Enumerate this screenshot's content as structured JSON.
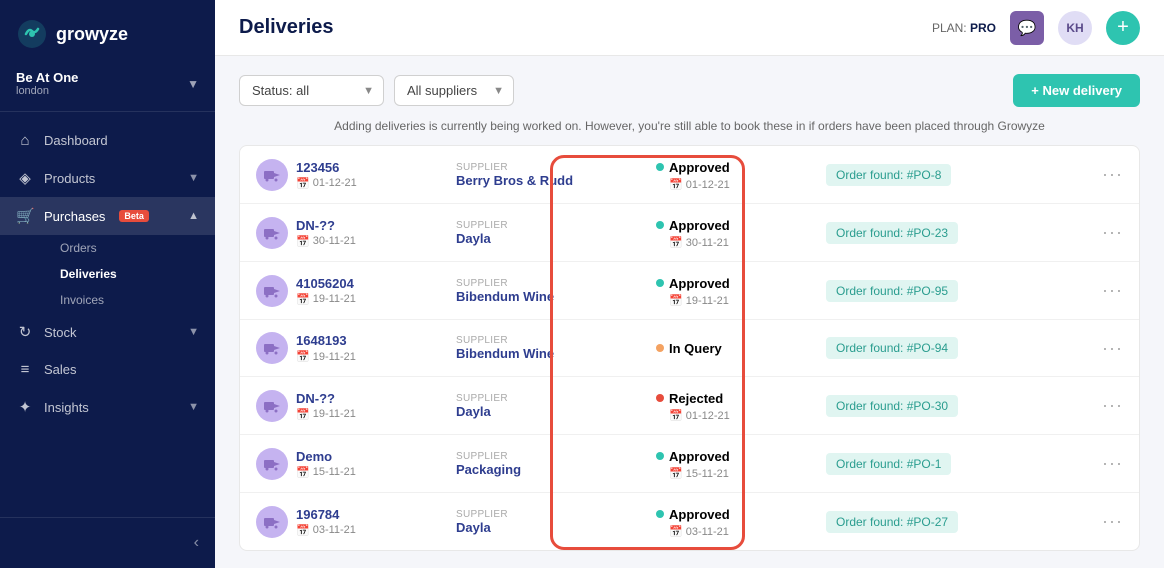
{
  "app": {
    "logo_text": "growyze",
    "plan_label": "PLAN:",
    "plan_value": "PRO",
    "avatar_initials": "KH"
  },
  "sidebar": {
    "org_name": "Be At One",
    "org_location": "london",
    "nav_items": [
      {
        "id": "dashboard",
        "label": "Dashboard",
        "icon": "🏠",
        "active": false
      },
      {
        "id": "products",
        "label": "Products",
        "icon": "🚀",
        "active": false,
        "has_chevron": true
      },
      {
        "id": "purchases",
        "label": "Purchases",
        "icon": "🛒",
        "active": true,
        "badge": "Beta",
        "has_chevron": true
      },
      {
        "id": "stock",
        "label": "Stock",
        "icon": "🔄",
        "active": false,
        "has_chevron": true
      },
      {
        "id": "sales",
        "label": "Sales",
        "icon": "💰",
        "active": false
      },
      {
        "id": "insights",
        "label": "Insights",
        "icon": "✨",
        "active": false,
        "has_chevron": true
      }
    ],
    "sub_items": [
      {
        "id": "orders",
        "label": "Orders"
      },
      {
        "id": "deliveries",
        "label": "Deliveries",
        "active": true
      },
      {
        "id": "invoices",
        "label": "Invoices"
      }
    ]
  },
  "page": {
    "title": "Deliveries",
    "info_text": "Adding deliveries is currently being worked on. However, you're still able to book these in if orders have been placed through Growyze"
  },
  "toolbar": {
    "status_label": "Status: all",
    "supplier_label": "All suppliers",
    "new_delivery_label": "+ New delivery"
  },
  "deliveries": [
    {
      "id": "123456",
      "date": "01-12-21",
      "supplier_label": "Supplier",
      "supplier": "Berry Bros & Rudd",
      "status": "Approved",
      "status_type": "approved",
      "status_date": "01-12-21",
      "order": "Order found: #PO-8"
    },
    {
      "id": "DN-??",
      "date": "30-11-21",
      "supplier_label": "Supplier",
      "supplier": "Dayla",
      "status": "Approved",
      "status_type": "approved",
      "status_date": "30-11-21",
      "order": "Order found: #PO-23"
    },
    {
      "id": "41056204",
      "date": "19-11-21",
      "supplier_label": "Supplier",
      "supplier": "Bibendum Wine",
      "status": "Approved",
      "status_type": "approved",
      "status_date": "19-11-21",
      "order": "Order found: #PO-95"
    },
    {
      "id": "1648193",
      "date": "19-11-21",
      "supplier_label": "Supplier",
      "supplier": "Bibendum Wine",
      "status": "In Query",
      "status_type": "inquery",
      "status_date": "",
      "order": "Order found: #PO-94"
    },
    {
      "id": "DN-??",
      "date": "19-11-21",
      "supplier_label": "Supplier",
      "supplier": "Dayla",
      "status": "Rejected",
      "status_type": "rejected",
      "status_date": "01-12-21",
      "order": "Order found: #PO-30"
    },
    {
      "id": "Demo",
      "date": "15-11-21",
      "supplier_label": "Supplier",
      "supplier": "Packaging",
      "status": "Approved",
      "status_type": "approved",
      "status_date": "15-11-21",
      "order": "Order found: #PO-1"
    },
    {
      "id": "196784",
      "date": "03-11-21",
      "supplier_label": "Supplier",
      "supplier": "Dayla",
      "status": "Approved",
      "status_type": "approved",
      "status_date": "03-11-21",
      "order": "Order found: #PO-27"
    }
  ],
  "status_colors": {
    "approved": "#2ec4b0",
    "inquery": "#f4a261",
    "rejected": "#e74c3c"
  }
}
